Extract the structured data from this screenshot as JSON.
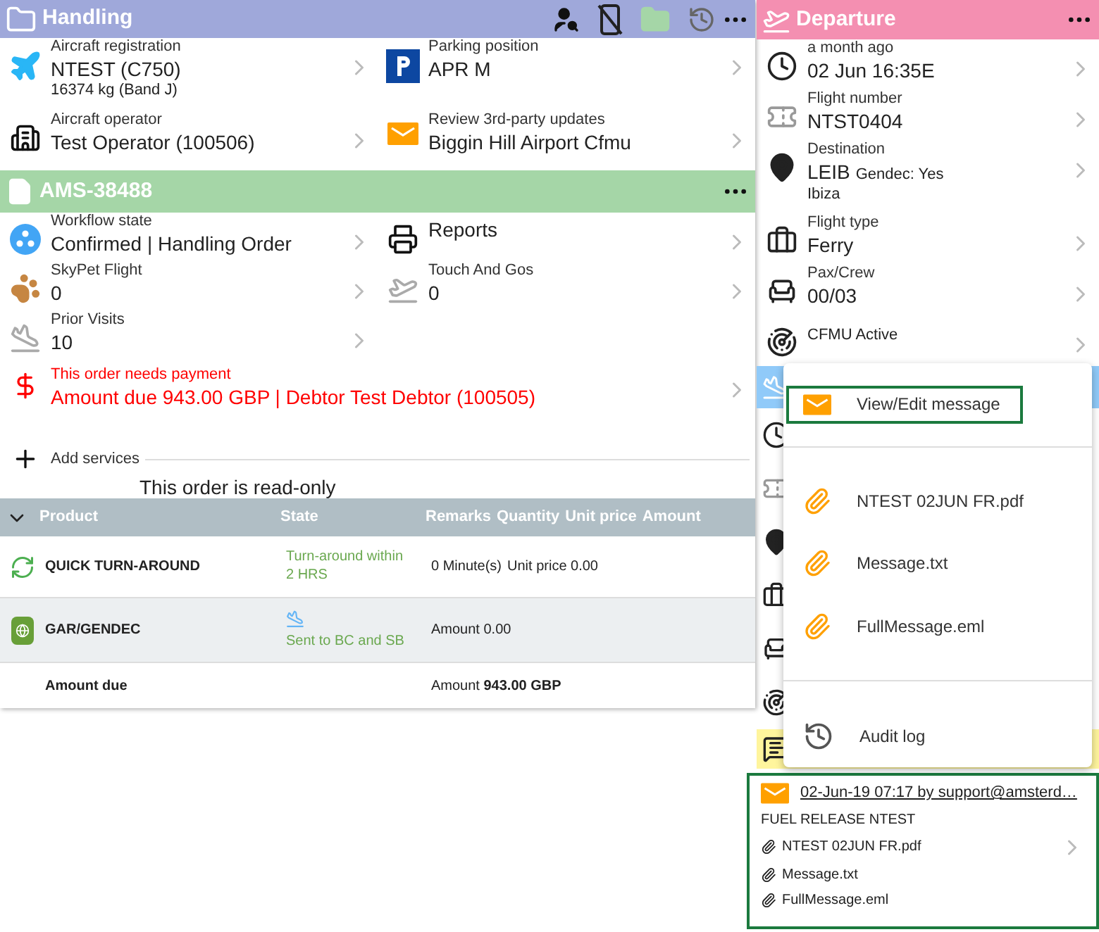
{
  "handling": {
    "title": "Handling",
    "fields": [
      {
        "label": "Aircraft registration",
        "value": "NTEST (C750)",
        "sub": "16374 kg (Band J)"
      },
      {
        "label": "Parking position",
        "value": "APR M"
      },
      {
        "label": "Aircraft operator",
        "value": "Test Operator (100506)"
      },
      {
        "label": "Review 3rd-party updates",
        "value": "Biggin Hill Airport  Cfmu"
      }
    ]
  },
  "order": {
    "title": "AMS-38488",
    "fields": [
      {
        "label": "Workflow state",
        "value": "Confirmed | Handling Order"
      },
      {
        "value": "Reports"
      },
      {
        "label": "SkyPet Flight",
        "value": "0"
      },
      {
        "label": "Touch And Gos",
        "value": "0"
      },
      {
        "label": "Prior Visits",
        "value": "10"
      }
    ],
    "payment": {
      "label": "This order needs payment",
      "value": "Amount due 943.00 GBP | Debtor Test Debtor (100505)"
    },
    "add_services": "Add services",
    "read_only_note": "This order is read-only",
    "table": {
      "columns": [
        "Product",
        "State",
        "Remarks",
        "Quantity",
        "Unit price",
        "Amount"
      ],
      "rows": [
        {
          "product": "QUICK TURN-AROUND",
          "state": "Turn-around within 2 HRS",
          "details": [
            "0 Minute(s)",
            "Unit price 0.00"
          ]
        },
        {
          "product": "GAR/GENDEC",
          "state": "Sent to BC and SB",
          "details": [
            "Amount 0.00"
          ]
        }
      ],
      "total": {
        "label": "Amount due",
        "value": "Amount **943.00 GBP**"
      }
    }
  },
  "departure": {
    "title": "Departure",
    "fields": [
      {
        "label": "a month ago",
        "value": "02 Jun 16:35E"
      },
      {
        "label": "Flight number",
        "value": "NTST0404"
      },
      {
        "label": "Destination",
        "value": "LEIB",
        "extra": "Gendec: Yes",
        "sub": "Ibiza"
      },
      {
        "label": "Flight type",
        "value": "Ferry"
      },
      {
        "label": "Pax/Crew",
        "value": "00/03"
      },
      {
        "small": "CFMU Active"
      }
    ]
  },
  "menu": {
    "items": [
      {
        "kind": "message",
        "label": "View/Edit message",
        "highlighted": true
      },
      {
        "kind": "divider"
      },
      {
        "kind": "attachment",
        "label": "NTEST 02JUN FR.pdf",
        "highlighted": false
      },
      {
        "kind": "attachment",
        "label": "Message.txt",
        "highlighted": false
      },
      {
        "kind": "attachment",
        "label": "FullMessage.eml",
        "highlighted": false
      },
      {
        "kind": "divider"
      },
      {
        "kind": "audit",
        "label": "Audit log",
        "highlighted": false
      }
    ]
  },
  "message": {
    "highlighted": true,
    "link": "02-Jun-19 07:17 by support@amsterd…",
    "subject": "FUEL RELEASE NTEST",
    "attachments": [
      "NTEST 02JUN FR.pdf",
      "Message.txt",
      "FullMessage.eml"
    ]
  }
}
